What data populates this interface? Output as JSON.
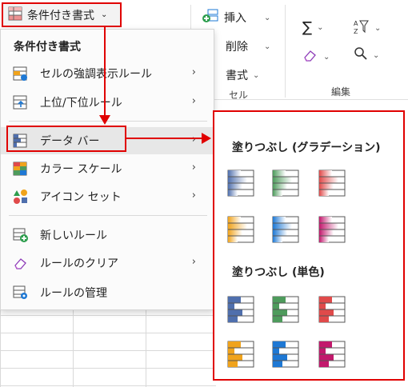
{
  "toolbar": {
    "trigger_label": "条件付き書式",
    "insert_label": "挿入",
    "delete_label": "削除",
    "format_label": "書式",
    "cells_group_label": "セル",
    "edit_group_label": "編集"
  },
  "menu": {
    "title": "条件付き書式",
    "items": [
      {
        "label": "セルの強調表示ルール",
        "icon": "highlight-cells-rules-icon",
        "submenu": true
      },
      {
        "label": "上位/下位ルール",
        "icon": "top-bottom-rules-icon",
        "submenu": true
      },
      {
        "label": "データ バー",
        "icon": "data-bars-icon",
        "submenu": true,
        "highlighted": true
      },
      {
        "label": "カラー スケール",
        "icon": "color-scales-icon",
        "submenu": true
      },
      {
        "label": "アイコン セット",
        "icon": "icon-sets-icon",
        "submenu": true
      },
      {
        "label": "新しいルール",
        "icon": "new-rule-icon",
        "submenu": false
      },
      {
        "label": "ルールのクリア",
        "icon": "clear-rules-icon",
        "submenu": true
      },
      {
        "label": "ルールの管理",
        "icon": "manage-rules-icon",
        "submenu": false
      }
    ]
  },
  "submenu": {
    "gradient_title": "塗りつぶし (グラデーション)",
    "solid_title": "塗りつぶし (単色)",
    "gradient_colors": [
      "#4f6fad",
      "#4e9b5c",
      "#e04a4a",
      "#f0a31c",
      "#1e78d4",
      "#c2186c"
    ],
    "solid_colors": [
      "#4f6fad",
      "#4e9b5c",
      "#e04a4a",
      "#f0a31c",
      "#1e78d4",
      "#c2186c"
    ]
  },
  "colors": {
    "annotation": "#e00000"
  }
}
